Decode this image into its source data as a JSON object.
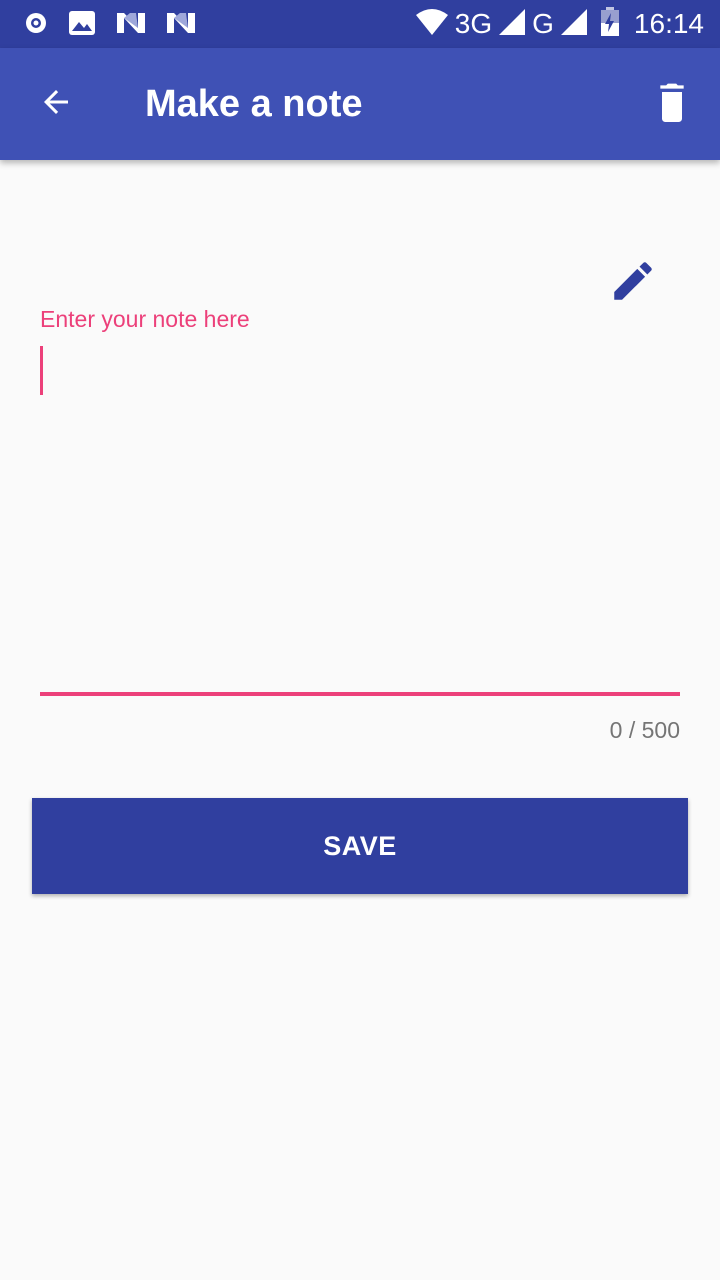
{
  "status_bar": {
    "network_3g": "3G",
    "network_g": "G",
    "time": "16:14",
    "left_icons": [
      "radio-icon",
      "image-icon",
      "n-logo-icon",
      "n-logo-icon"
    ],
    "right_icons": [
      "wifi-icon",
      "signal-icon",
      "signal-icon",
      "battery-charging-icon"
    ]
  },
  "app_bar": {
    "title": "Make a note",
    "back_icon": "arrow-back-icon",
    "delete_icon": "trash-icon",
    "color": "#3f51b5"
  },
  "note": {
    "hint": "Enter your note here",
    "value": "",
    "counter": "0 / 500",
    "accent_color": "#ec407a",
    "edit_icon": "pencil-icon"
  },
  "actions": {
    "save_label": "SAVE",
    "save_color": "#303f9f"
  }
}
